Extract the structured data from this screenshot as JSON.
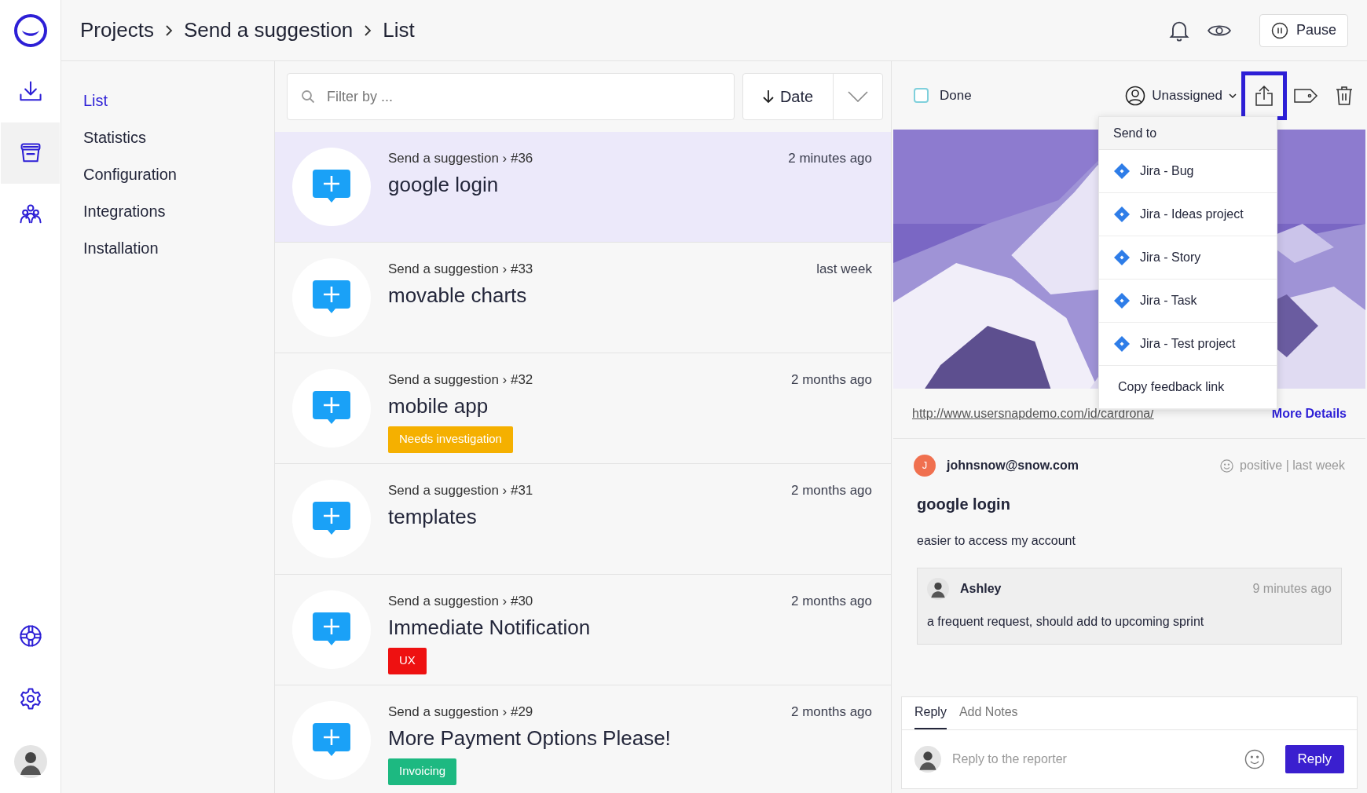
{
  "rail": {
    "top": [
      {
        "kind": "download",
        "selected": false
      },
      {
        "kind": "archive",
        "selected": true
      },
      {
        "kind": "team",
        "selected": false
      }
    ],
    "bottom": [
      {
        "kind": "help"
      },
      {
        "kind": "settings"
      }
    ]
  },
  "header": {
    "breadcrumb": [
      "Projects",
      "Send a suggestion",
      "List"
    ],
    "pause_button": "Pause"
  },
  "nav": [
    {
      "label": "List",
      "selected": true
    },
    {
      "label": "Statistics",
      "selected": false
    },
    {
      "label": "Configuration",
      "selected": false
    },
    {
      "label": "Integrations",
      "selected": false
    },
    {
      "label": "Installation",
      "selected": false
    }
  ],
  "filter": {
    "placeholder": "Filter by ..."
  },
  "sort": {
    "label": "Date"
  },
  "feedback": [
    {
      "project": "Send a suggestion › #36",
      "title": "google login",
      "time": "2 minutes ago",
      "selected": true
    },
    {
      "project": "Send a suggestion › #33",
      "title": "movable charts",
      "time": "last week",
      "selected": false
    },
    {
      "project": "Send a suggestion › #32",
      "title": "mobile app",
      "time": "2 months ago",
      "selected": false,
      "tag": {
        "label": "Needs investigation",
        "color": "#f5b000"
      }
    },
    {
      "project": "Send a suggestion › #31",
      "title": "templates",
      "time": "2 months ago",
      "selected": false
    },
    {
      "project": "Send a suggestion › #30",
      "title": "Immediate Notification",
      "time": "2 months ago",
      "selected": false,
      "tag": {
        "label": "UX",
        "color": "#ee1111"
      }
    },
    {
      "project": "Send a suggestion › #29",
      "title": "More Payment Options Please!",
      "time": "2 months ago",
      "selected": false,
      "tag": {
        "label": "Invoicing",
        "color": "#1db981"
      }
    }
  ],
  "detail": {
    "done": {
      "label": "Done",
      "checked": false
    },
    "assignee": "Unassigned",
    "send_menu": {
      "open": true,
      "title": "Send to",
      "items": [
        {
          "label": "Jira - Bug",
          "kind": "jira"
        },
        {
          "label": "Jira - Ideas project",
          "kind": "jira"
        },
        {
          "label": "Jira - Story",
          "kind": "jira"
        },
        {
          "label": "Jira - Task",
          "kind": "jira"
        },
        {
          "label": "Jira - Test project",
          "kind": "jira"
        },
        {
          "label": "Copy feedback link",
          "kind": "plain"
        }
      ]
    },
    "url": "http://www.usersnapdemo.com/id/cardrona/",
    "more_details": "More Details",
    "reporter": {
      "initial": "J",
      "email": "johnsnow@snow.com",
      "meta": "positive | last week"
    },
    "title": "google login",
    "message": "easier to access my account",
    "note": {
      "author": "Ashley",
      "time": "9 minutes ago",
      "text": "a frequent request, should add to upcoming sprint"
    },
    "reply_tabs": [
      {
        "label": "Reply",
        "selected": true
      },
      {
        "label": "Add Notes",
        "selected": false
      }
    ],
    "reply_placeholder": "Reply to the reporter",
    "reply_button": "Reply"
  }
}
